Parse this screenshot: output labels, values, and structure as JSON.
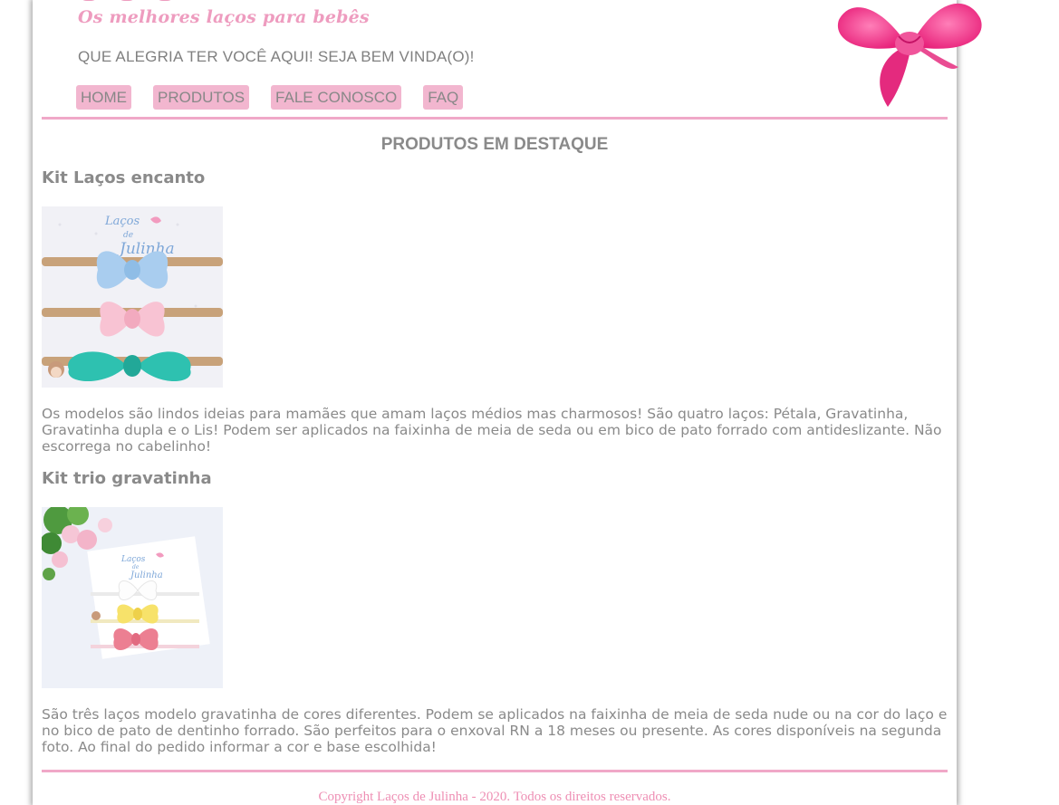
{
  "header": {
    "tagline": "Os melhores laços para bebês",
    "welcome": "QUE ALEGRIA TER VOCÊ AQUI! SEJA BEM VINDA(O)!"
  },
  "nav": {
    "items": [
      {
        "label": "HOME"
      },
      {
        "label": "PRODUTOS"
      },
      {
        "label": "FALE CONOSCO"
      },
      {
        "label": "FAQ"
      }
    ]
  },
  "main": {
    "section_title": "PRODUTOS EM DESTAQUE",
    "products": [
      {
        "title": "Kit Laços encanto",
        "image_icon": "bow-kit-photo-blue-pink-teal",
        "image_label_top": "Laços",
        "image_label_mid": "de",
        "image_label_bottom": "Julinha",
        "description": "Os modelos são lindos ideias para mamães que amam laços médios mas charmosos! São quatro laços: Pétala, Gravatinha, Gravatinha dupla e o Lis! Podem ser aplicados na faixinha de meia de seda ou em bico de pato forrado com antideslizante. Não escorrega no cabelinho!"
      },
      {
        "title": "Kit trio gravatinha",
        "image_icon": "bow-kit-photo-white-yellow-pink",
        "image_label_top": "Laços",
        "image_label_mid": "de",
        "image_label_bottom": "Julinha",
        "description": "São três laços modelo gravatinha de cores diferentes. Podem se aplicados na faixinha de meia de seda nude ou na cor do laço e no bico de pato de dentinho forrado. São perfeitos para o enxoval RN a 18 meses ou presente. As cores disponíveis na segunda foto. Ao final do pedido informar a cor e base escolhida!"
      }
    ]
  },
  "footer": {
    "copyright": "Copyright Laços de Julinha - 2020. Todos os direitos reservados."
  },
  "colors": {
    "accent_pink": "#f2b6cf",
    "rule_pink": "#f0a8c8",
    "text_gray": "#8a8a8a",
    "footer_pink": "#ee8fb4"
  }
}
